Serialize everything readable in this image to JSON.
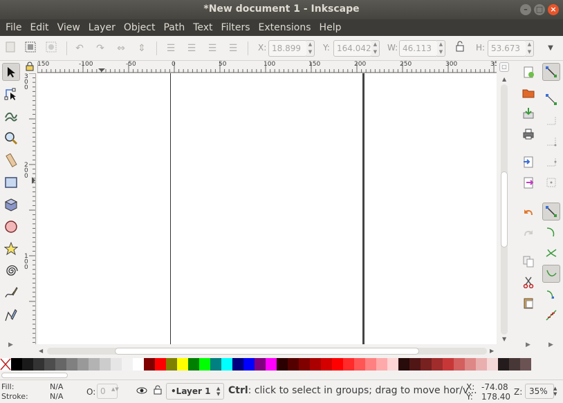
{
  "window": {
    "title": "*New document 1 - Inkscape"
  },
  "menu": [
    "File",
    "Edit",
    "View",
    "Layer",
    "Object",
    "Path",
    "Text",
    "Filters",
    "Extensions",
    "Help"
  ],
  "toolbar": {
    "x_label": "X:",
    "x_value": "18.899",
    "y_label": "Y:",
    "y_value": "164.042",
    "w_label": "W:",
    "w_value": "46.113",
    "h_label": "H:",
    "h_value": "53.673"
  },
  "ruler": {
    "h_ticks": [
      "150",
      "-100",
      "-50",
      "0",
      "50",
      "100",
      "150",
      "200",
      "250",
      "300",
      "35"
    ],
    "v_ticks": [
      "3",
      "0",
      "0",
      "2",
      "0",
      "0",
      "1",
      "0",
      "0"
    ]
  },
  "status": {
    "fill_label": "Fill:",
    "fill_value": "N/A",
    "stroke_label": "Stroke:",
    "stroke_value": "N/A",
    "opacity_label": "O:",
    "opacity_value": "0",
    "layer": "•Layer 1",
    "message_bold": "Ctrl",
    "message": ": click to select in groups; drag to move hor/v...",
    "x_label": "X:",
    "x_value": "-74.08",
    "y_label": "Y:",
    "y_value": "178.40",
    "zoom_label": "Z:",
    "zoom_value": "35%"
  },
  "palette": [
    "#000000",
    "#1a1a1a",
    "#333333",
    "#4d4d4d",
    "#666666",
    "#808080",
    "#999999",
    "#b3b3b3",
    "#cccccc",
    "#e6e6e6",
    "#f2f2f2",
    "#ffffff",
    "#800000",
    "#ff0000",
    "#808000",
    "#ffff00",
    "#008000",
    "#00ff00",
    "#008080",
    "#00ffff",
    "#000080",
    "#0000ff",
    "#800080",
    "#ff00ff",
    "#2b0000",
    "#550000",
    "#800000",
    "#aa0000",
    "#d40000",
    "#ff0000",
    "#ff2a2a",
    "#ff5555",
    "#ff8080",
    "#ffaaaa",
    "#ffd5d5",
    "#280b0b",
    "#501616",
    "#782121",
    "#a02c2c",
    "#c83737",
    "#d35f5f",
    "#de8787",
    "#e9afaf",
    "#f4d7d7",
    "#241c1c",
    "#483737",
    "#6c5353"
  ],
  "colors": {
    "titlebar": "#4b4a45",
    "menubar": "#3c3b37",
    "accent": "#e9542a"
  }
}
